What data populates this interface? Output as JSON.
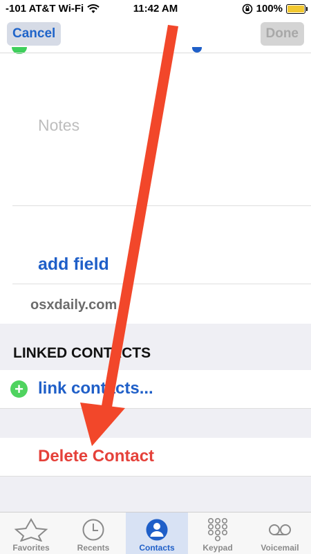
{
  "status_bar": {
    "carrier": "-101 AT&T Wi-Fi",
    "time": "11:42 AM",
    "battery": "100%",
    "battery_level": 1.0
  },
  "nav": {
    "cancel_label": "Cancel",
    "done_label": "Done"
  },
  "content": {
    "notes_label": "Notes",
    "add_field_label": "add field",
    "website": "osxdaily.com",
    "linked_contacts_header": "LINKED CONTACTS",
    "link_contacts_label": "link contacts...",
    "delete_contact_label": "Delete Contact"
  },
  "tabs": [
    {
      "label": "Favorites",
      "icon": "star-icon",
      "active": false
    },
    {
      "label": "Recents",
      "icon": "clock-icon",
      "active": false
    },
    {
      "label": "Contacts",
      "icon": "contact-person-icon",
      "active": true
    },
    {
      "label": "Keypad",
      "icon": "keypad-icon",
      "active": false
    },
    {
      "label": "Voicemail",
      "icon": "voicemail-icon",
      "active": false
    }
  ],
  "colors": {
    "ios_blue": "#1f5fc8",
    "delete_red": "#e5413a",
    "add_green": "#4fd35f",
    "annotation_arrow": "#f2472a"
  }
}
